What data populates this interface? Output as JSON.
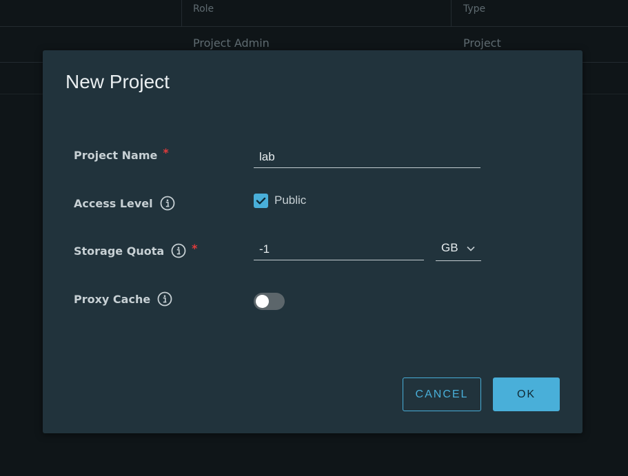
{
  "background": {
    "columns": [
      "Role",
      "Type"
    ],
    "row": {
      "role": "Project Admin",
      "type": "Project"
    }
  },
  "dialog": {
    "title": "New Project",
    "project_name": {
      "label": "Project Name",
      "value": "lab",
      "required_mark": "*"
    },
    "access_level": {
      "label": "Access Level",
      "checkbox_label": "Public",
      "checked": true
    },
    "storage_quota": {
      "label": "Storage Quota",
      "value": "-1",
      "unit": "GB",
      "required_mark": "*"
    },
    "proxy_cache": {
      "label": "Proxy Cache",
      "enabled": false
    },
    "buttons": {
      "cancel": "CANCEL",
      "ok": "OK"
    }
  },
  "colors": {
    "accent": "#49afd9",
    "modal_bg": "#21333c",
    "required": "#e03b3b"
  },
  "icons": [
    "info-icon",
    "check-icon",
    "chevron-down-icon"
  ]
}
